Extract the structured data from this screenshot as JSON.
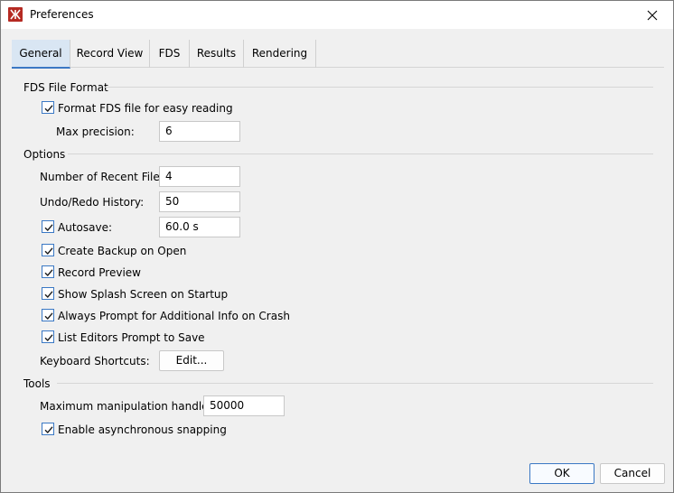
{
  "window": {
    "title": "Preferences"
  },
  "tabs": [
    "General",
    "Record View",
    "FDS",
    "Results",
    "Rendering"
  ],
  "sections": {
    "fds": {
      "title": "FDS File Format",
      "format_checkbox": {
        "label": "Format FDS file for easy reading",
        "checked": true
      },
      "max_precision": {
        "label": "Max precision:",
        "value": "6"
      }
    },
    "options": {
      "title": "Options",
      "recent_files": {
        "label": "Number of Recent Files:",
        "value": "4"
      },
      "undo_history": {
        "label": "Undo/Redo History:",
        "value": "50"
      },
      "autosave": {
        "label": "Autosave:",
        "value": "60.0 s",
        "checked": true
      },
      "backup": {
        "label": "Create Backup on Open",
        "checked": true
      },
      "record_preview": {
        "label": "Record Preview",
        "checked": true
      },
      "splash": {
        "label": "Show Splash Screen on Startup",
        "checked": true
      },
      "crash_prompt": {
        "label": "Always Prompt for Additional Info on Crash",
        "checked": true
      },
      "list_editors": {
        "label": "List Editors Prompt to Save",
        "checked": true
      },
      "shortcuts": {
        "label": "Keyboard Shortcuts:",
        "button": "Edit..."
      }
    },
    "tools": {
      "title": "Tools",
      "max_handles": {
        "label": "Maximum manipulation handles:",
        "value": "50000"
      },
      "async_snapping": {
        "label": "Enable asynchronous snapping",
        "checked": true
      }
    }
  },
  "footer": {
    "ok": "OK",
    "cancel": "Cancel"
  },
  "colors": {
    "accent": "#3a78c4",
    "tab_active_bg": "#d9e6f3",
    "app_icon": "#b52a22"
  }
}
